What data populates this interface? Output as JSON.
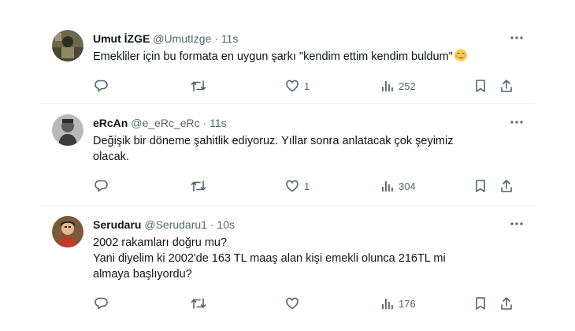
{
  "tweets": [
    {
      "name": "Umut İZGE",
      "handle": "@UmutIzge",
      "time": "11s",
      "lines": [
        "Emekliler için bu formata en uygun şarkı \"kendim ettim kendim buldum\""
      ],
      "emoji": "smiling-face-emoji",
      "likes": "1",
      "views": "252"
    },
    {
      "name": "eRcAn",
      "handle": "@e_eRc_eRc",
      "time": "11s",
      "lines": [
        "Değişik bir döneme şahitlik ediyoruz. Yıllar sonra anlatacak çok şeyimiz",
        "olacak."
      ],
      "likes": "1",
      "views": "304"
    },
    {
      "name": "Serudaru",
      "handle": "@Serudaru1",
      "time": "10s",
      "lines": [
        "2002 rakamları doğru mu?",
        "Yani diyelim ki 2002'de 163 TL maaş alan kişi emekli olunca 216TL mi",
        "almaya başlıyordu?"
      ],
      "likes": "",
      "views": "176"
    }
  ],
  "separator": "·",
  "icons": {
    "reply": "reply-icon",
    "retweet": "retweet-icon",
    "like": "heart-icon",
    "views": "views-chart-icon",
    "bookmark": "bookmark-icon",
    "share": "share-icon",
    "more": "more-options-icon"
  },
  "colors": {
    "text": "#0f1419",
    "secondary": "#536471",
    "divider": "#eff3f4"
  }
}
